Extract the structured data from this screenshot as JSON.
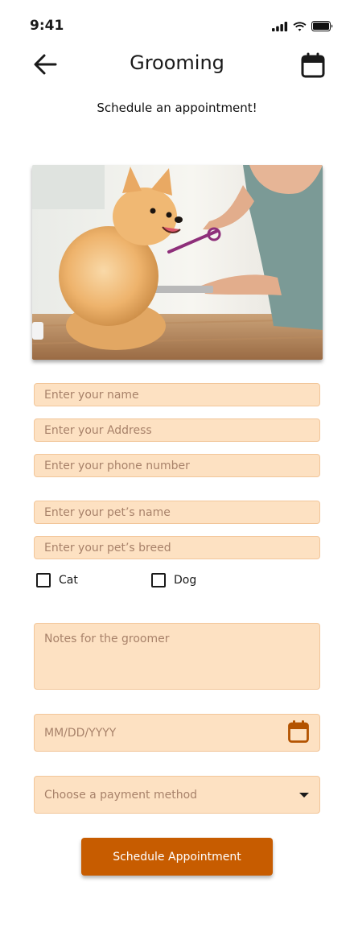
{
  "status_bar": {
    "time": "9:41"
  },
  "header": {
    "title": "Grooming",
    "subtitle": "Schedule an appointment!"
  },
  "form": {
    "name_placeholder": "Enter your name",
    "address_placeholder": "Enter your Address",
    "phone_placeholder": "Enter your phone number",
    "pet_name_placeholder": "Enter your pet’s name",
    "pet_breed_placeholder": "Enter your pet’s breed",
    "cat_label": "Cat",
    "dog_label": "Dog",
    "notes_placeholder": "Notes for the groomer",
    "date_placeholder": "MM/DD/YYYY",
    "payment_placeholder": "Choose a payment method",
    "submit_label": "Schedule Appointment"
  },
  "colors": {
    "field_bg": "#fde1c2",
    "accent": "#c75c00",
    "placeholder": "#a8826a"
  }
}
